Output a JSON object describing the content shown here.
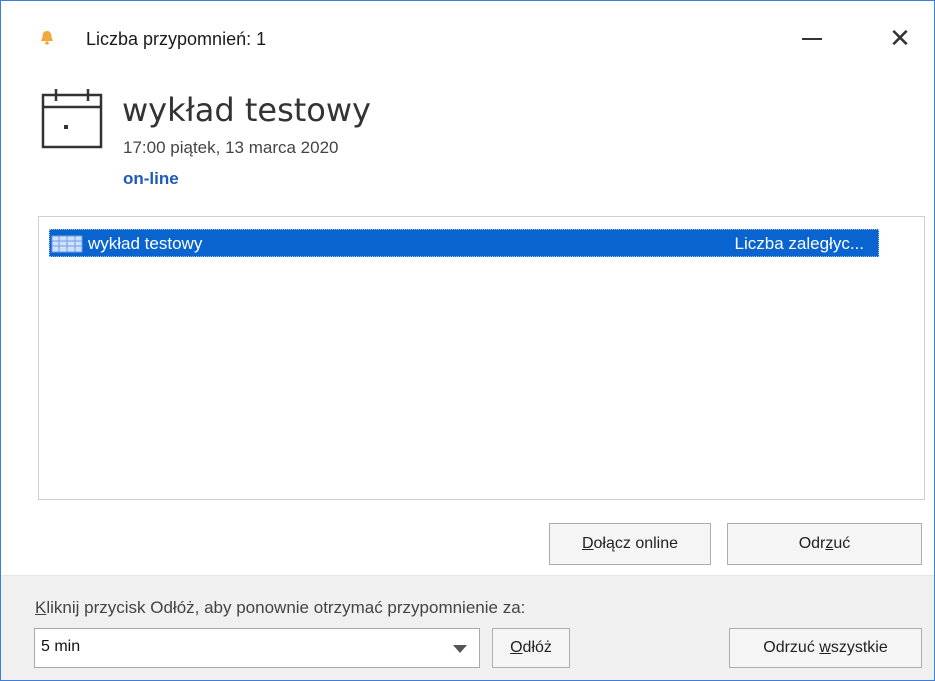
{
  "window": {
    "title": "Liczba przypomnień: 1",
    "minimize_symbol": "—",
    "close_symbol": "✕",
    "title_icon": "bell-icon",
    "accent_color": "#0a64d0"
  },
  "event": {
    "icon": "calendar-icon",
    "title": "wykład testowy",
    "time": "17:00 piątek, 13 marca 2020",
    "location": "on-line"
  },
  "reminders": [
    {
      "subject": "wykład testowy",
      "due": "Liczba zaległyc...",
      "selected": true
    }
  ],
  "buttons": {
    "join_online": {
      "before": "",
      "accel": "D",
      "after": "ołącz online"
    },
    "dismiss": {
      "before": "Odr",
      "accel": "z",
      "after": "uć"
    },
    "snooze": {
      "before": "",
      "accel": "O",
      "after": "dłóż"
    },
    "dismiss_all": {
      "before": "Odrzuć ",
      "accel": "w",
      "after": "szystkie"
    }
  },
  "snooze": {
    "label_accel": "K",
    "label_rest": "liknij przycisk Odłóż, aby ponownie otrzymać przypomnienie za:",
    "selected_value": "5 min"
  }
}
